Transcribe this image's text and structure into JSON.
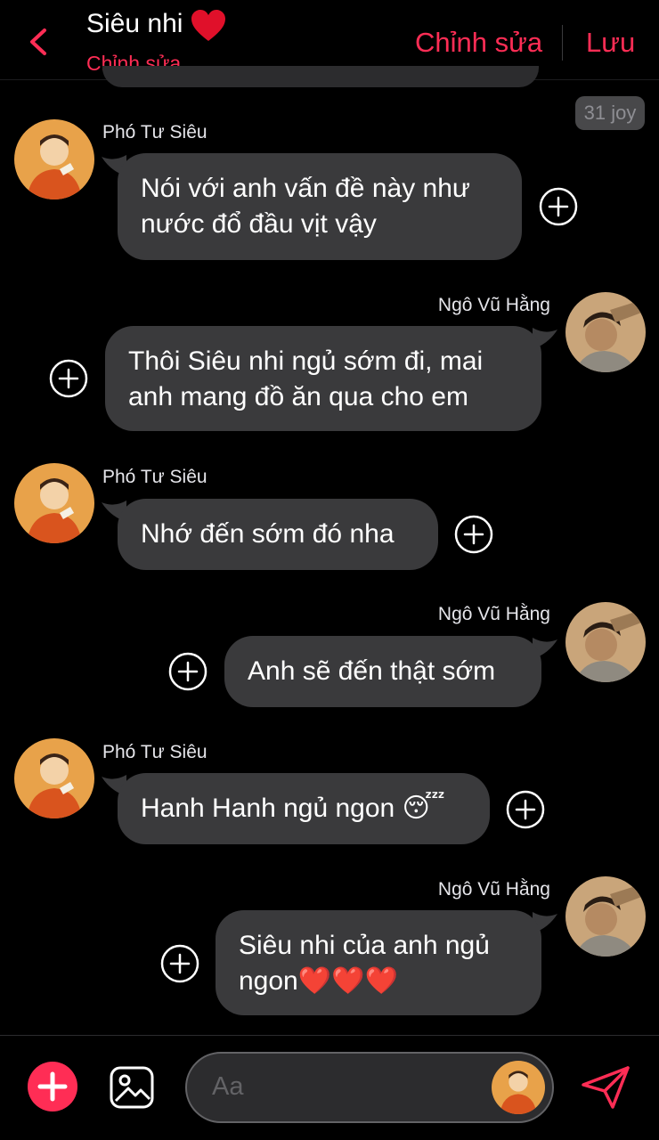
{
  "header": {
    "title": "Siêu nhi",
    "subtitle": "Chỉnh sửa",
    "edit_label": "Chỉnh sửa",
    "save_label": "Lưu"
  },
  "time_badge": "31 joy",
  "messages": [
    {
      "sender": "Phó Tư Siêu",
      "side": "left",
      "lines": [
        "Nói với anh vấn đề này như",
        "nước đổ đầu vịt vậy"
      ]
    },
    {
      "sender": "Ngô Vũ Hằng",
      "side": "right",
      "lines": [
        "Thôi Siêu nhi ngủ sớm đi, mai",
        "anh mang đồ ăn qua cho em"
      ]
    },
    {
      "sender": "Phó Tư Siêu",
      "side": "left",
      "lines": [
        "Nhớ đến sớm đó nha"
      ]
    },
    {
      "sender": "Ngô Vũ Hằng",
      "side": "right",
      "lines": [
        "Anh sẽ đến thật sớm"
      ]
    },
    {
      "sender": "Phó Tư Siêu",
      "side": "left",
      "lines": [
        "Hanh Hanh ngủ ngon 😴"
      ]
    },
    {
      "sender": "Ngô Vũ Hằng",
      "side": "right",
      "lines": [
        "Siêu nhi của anh ngủ",
        "ngon❤️❤️❤️"
      ]
    }
  ],
  "composer": {
    "placeholder": "Aa"
  },
  "colors": {
    "accent": "#ff2d55",
    "bubble": "#3a3a3c",
    "background": "#000000"
  },
  "icons": [
    "back-chevron-icon",
    "heart-icon",
    "plus-circle-icon",
    "image-icon",
    "send-icon"
  ]
}
